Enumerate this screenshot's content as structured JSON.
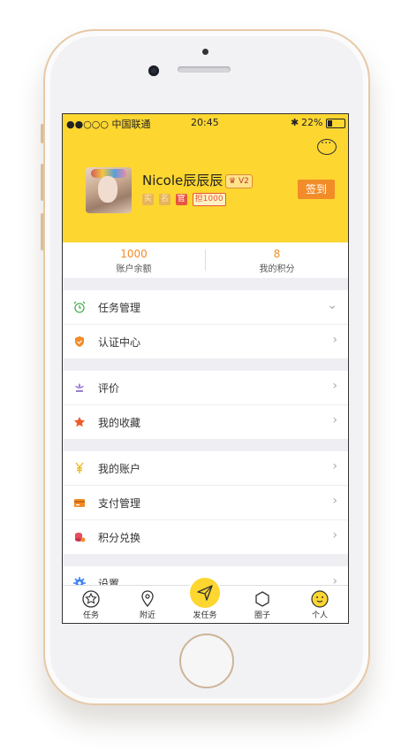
{
  "status_bar": {
    "carrier": "●●○○○ 中国联通",
    "time": "20:45",
    "battery": "22%"
  },
  "profile": {
    "name": "Nicole辰辰辰",
    "level_badge": "V2",
    "tags": [
      "实",
      "名",
      "官",
      "担1000"
    ],
    "signin_label": "签到"
  },
  "stats": [
    {
      "value": "1000",
      "label": "账户余额"
    },
    {
      "value": "8",
      "label": "我的积分"
    }
  ],
  "menu_groups": [
    {
      "items": [
        {
          "label": "任务管理",
          "icon": "alarm-clock-icon",
          "color": "#4caf50",
          "chevron": "⌄"
        },
        {
          "label": "认证中心",
          "icon": "shield-icon",
          "color": "#f28c28",
          "chevron": "›"
        }
      ]
    },
    {
      "items": [
        {
          "label": "评价",
          "icon": "flower-icon",
          "color": "#9b7fd1",
          "chevron": "›"
        },
        {
          "label": "我的收藏",
          "icon": "star-icon",
          "color": "#f05a28",
          "chevron": "›"
        }
      ]
    },
    {
      "items": [
        {
          "label": "我的账户",
          "icon": "yen-icon",
          "color": "#f2b51f",
          "chevron": "›"
        },
        {
          "label": "支付管理",
          "icon": "card-icon",
          "color": "#f28c28",
          "chevron": "›"
        },
        {
          "label": "积分兑换",
          "icon": "coins-icon",
          "color": "#e84a5f",
          "chevron": "›"
        }
      ]
    },
    {
      "items": [
        {
          "label": "设置",
          "icon": "gear-icon",
          "color": "#3b82f6",
          "chevron": "›"
        }
      ]
    }
  ],
  "tabbar": [
    {
      "label": "任务",
      "icon": "star-circle-icon"
    },
    {
      "label": "附近",
      "icon": "location-pin-icon"
    },
    {
      "label": "发任务",
      "icon": "paper-plane-icon"
    },
    {
      "label": "圈子",
      "icon": "hexagon-icon"
    },
    {
      "label": "个人",
      "icon": "smiley-icon"
    }
  ],
  "colors": {
    "accent": "#fdd630",
    "orange": "#f28c28"
  }
}
